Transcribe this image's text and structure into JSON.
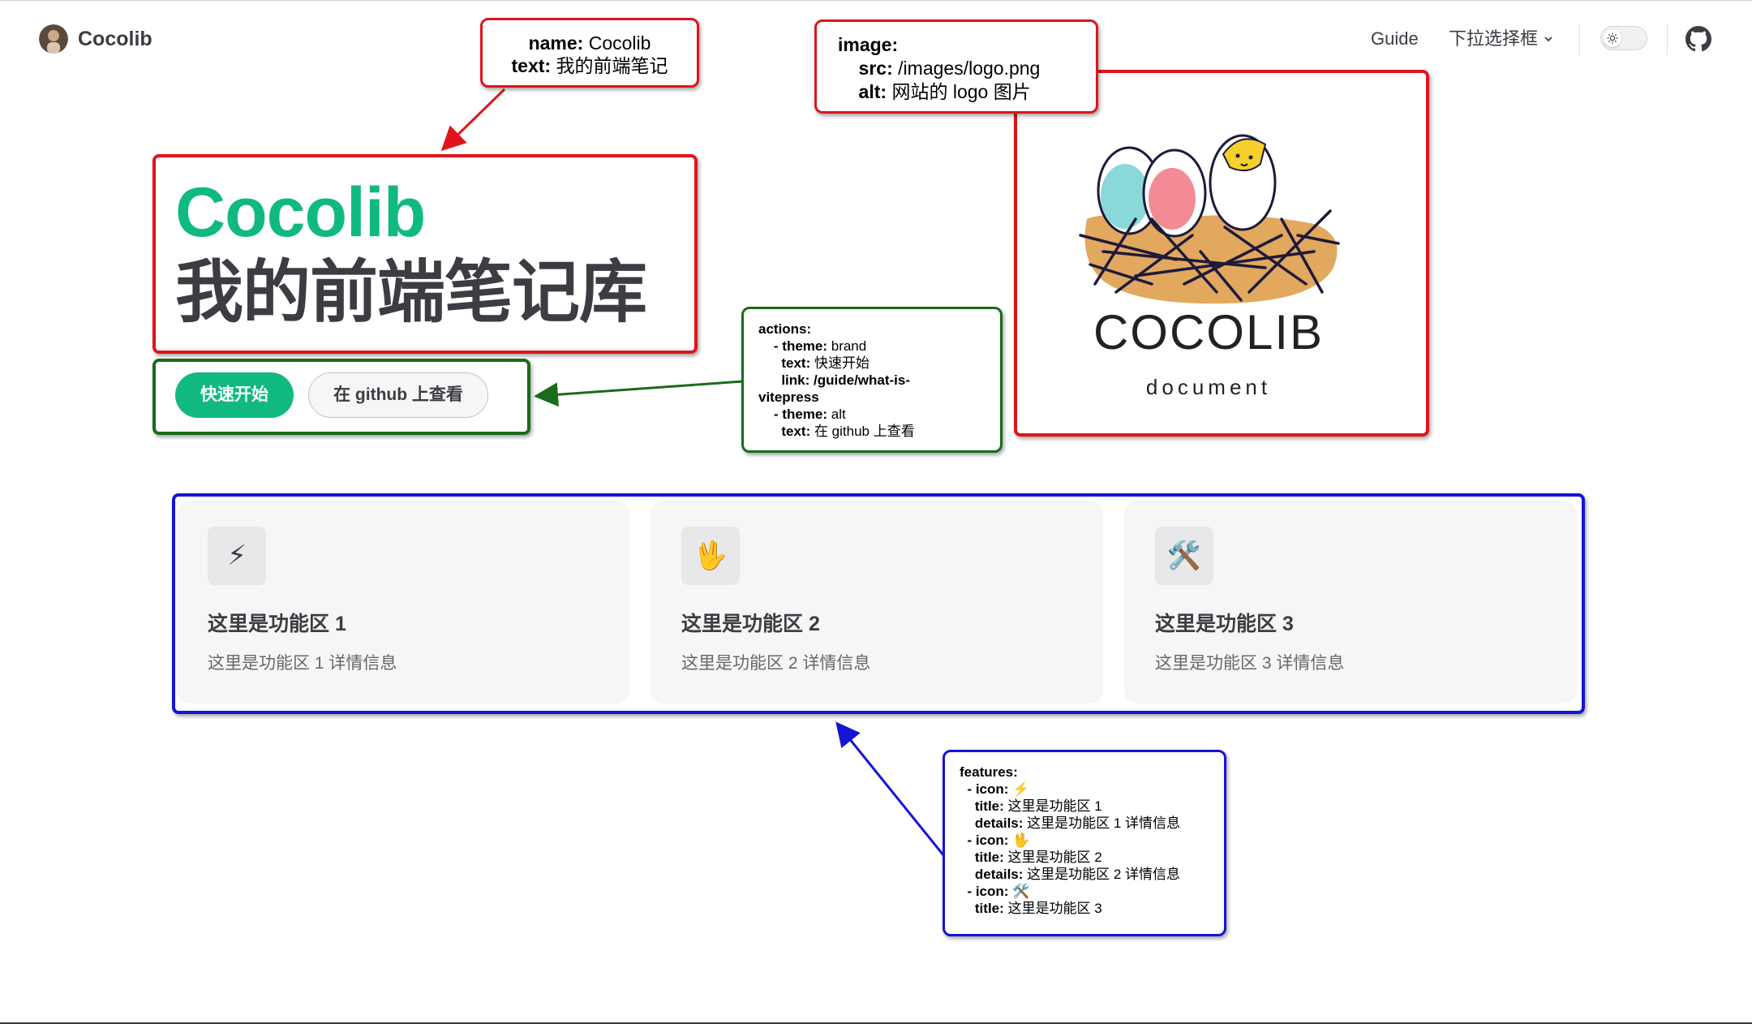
{
  "nav": {
    "site_title": "Cocolib",
    "links": [
      {
        "label": "Guide"
      },
      {
        "label": "下拉选择框"
      }
    ]
  },
  "hero": {
    "name": "Cocolib",
    "text": "我的前端笔记库",
    "actions": [
      {
        "theme": "brand",
        "text": "快速开始"
      },
      {
        "theme": "alt",
        "text": "在 github 上查看"
      }
    ],
    "image": {
      "logo_text": "COCOLIB",
      "logo_sub": "document"
    }
  },
  "features": [
    {
      "icon": "⚡",
      "title": "这里是功能区 1",
      "details": "这里是功能区 1 详情信息"
    },
    {
      "icon": "🖖",
      "title": "这里是功能区 2",
      "details": "这里是功能区 2 详情信息"
    },
    {
      "icon": "🛠️",
      "title": "这里是功能区 3",
      "details": "这里是功能区 3 详情信息"
    }
  ],
  "annotations": {
    "name_note": {
      "lines": [
        {
          "key": "name:",
          "value": " Cocolib"
        },
        {
          "key": "text:",
          "value": " 我的前端笔记"
        }
      ]
    },
    "image_note": {
      "lines": [
        {
          "key": "image:",
          "value": ""
        },
        {
          "key": "    src:",
          "value": " /images/logo.png"
        },
        {
          "key": "    alt:",
          "value": " 网站的 logo 图片"
        }
      ]
    },
    "actions_note": {
      "lines": [
        {
          "key": "actions:",
          "value": ""
        },
        {
          "key": "    - theme:",
          "value": " brand"
        },
        {
          "key": "      text:",
          "value": " 快速开始"
        },
        {
          "key": "      link:",
          "value": " /guide/what-is-"
        },
        {
          "key": "vitepress",
          "value": ""
        },
        {
          "key": "    - theme:",
          "value": " alt"
        },
        {
          "key": "      text:",
          "value": " 在 github 上查看"
        }
      ]
    },
    "features_note": {
      "lines": [
        {
          "key": "features:",
          "value": ""
        },
        {
          "key": "  - icon:",
          "value": " ⚡️"
        },
        {
          "key": "    title:",
          "value": " 这里是功能区 1"
        },
        {
          "key": "    details:",
          "value": " 这里是功能区 1 详情信息"
        },
        {
          "key": "  - icon:",
          "value": " 🖖"
        },
        {
          "key": "    title:",
          "value": " 这里是功能区 2"
        },
        {
          "key": "    details:",
          "value": " 这里是功能区 2 详情信息"
        },
        {
          "key": "  - icon:",
          "value": " 🛠️"
        },
        {
          "key": "    title:",
          "value": " 这里是功能区 3"
        }
      ]
    }
  },
  "colors": {
    "brand": "#10b981",
    "annotation_red": "#e0141b",
    "annotation_green": "#1a6b1a",
    "annotation_blue": "#1414d6"
  }
}
